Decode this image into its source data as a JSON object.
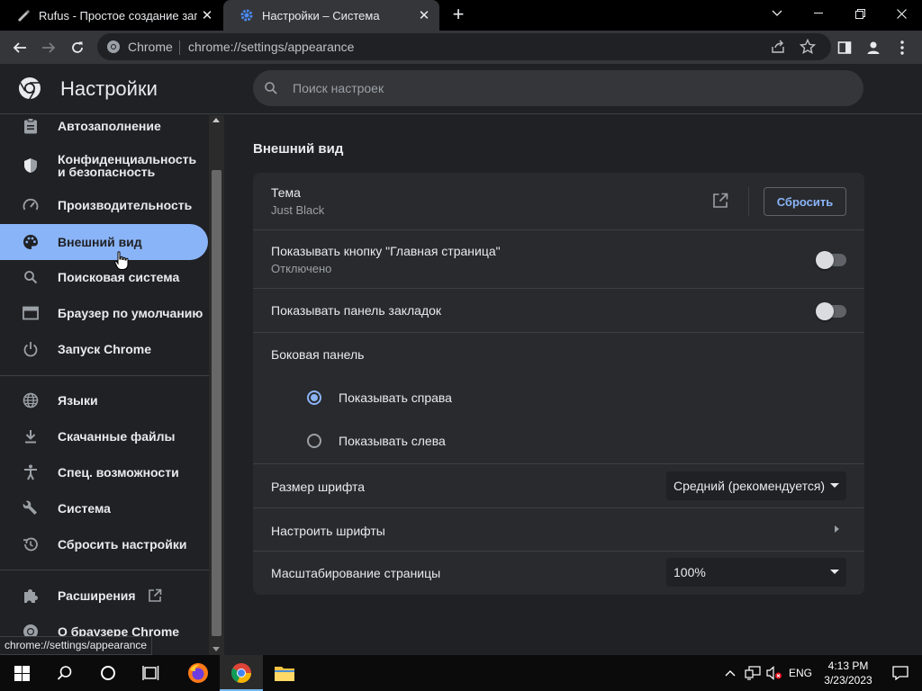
{
  "tabs": [
    {
      "title": "Rufus - Простое создание загру",
      "icon": "rufus-icon"
    },
    {
      "title": "Настройки – Система",
      "icon": "settings-gear-icon"
    }
  ],
  "omnibox": {
    "chip": "Chrome",
    "url": "chrome://settings/appearance"
  },
  "settings": {
    "title": "Настройки",
    "search_placeholder": "Поиск настроек"
  },
  "sidebar": {
    "items": [
      {
        "label": "Автозаполнение",
        "icon": "clipboard-icon"
      },
      {
        "label": "Конфиденциальность и безопасность",
        "icon": "shield-icon"
      },
      {
        "label": "Производительность",
        "icon": "speedometer-icon"
      },
      {
        "label": "Внешний вид",
        "icon": "palette-icon"
      },
      {
        "label": "Поисковая система",
        "icon": "search-icon"
      },
      {
        "label": "Браузер по умолчанию",
        "icon": "browser-window-icon"
      },
      {
        "label": "Запуск Chrome",
        "icon": "power-icon"
      },
      {
        "label": "Языки",
        "icon": "globe-icon"
      },
      {
        "label": "Скачанные файлы",
        "icon": "download-icon"
      },
      {
        "label": "Спец. возможности",
        "icon": "accessibility-icon"
      },
      {
        "label": "Система",
        "icon": "wrench-icon"
      },
      {
        "label": "Сбросить настройки",
        "icon": "history-reset-icon"
      },
      {
        "label": "Расширения",
        "icon": "puzzle-icon"
      },
      {
        "label": "О браузере Chrome",
        "icon": "chrome-logo-icon"
      }
    ]
  },
  "main": {
    "section_title": "Внешний вид",
    "theme_label": "Тема",
    "theme_value": "Just Black",
    "reset_button": "Сбросить",
    "home_button_label": "Показывать кнопку \"Главная страница\"",
    "home_button_status": "Отключено",
    "bookmarks_bar_label": "Показывать панель закладок",
    "side_panel_label": "Боковая панель",
    "side_panel_options": [
      "Показывать справа",
      "Показывать слева"
    ],
    "side_panel_selected": "Показывать справа",
    "font_size_label": "Размер шрифта",
    "font_size_value": "Средний (рекомендуется)",
    "customize_fonts_label": "Настроить шрифты",
    "page_zoom_label": "Масштабирование страницы",
    "page_zoom_value": "100%"
  },
  "status_bubble": "chrome://settings/appearance",
  "taskbar": {
    "language": "ENG",
    "time": "4:13 PM",
    "date": "3/23/2023"
  },
  "colors": {
    "accent": "#8ab4f8",
    "background": "#202124",
    "card": "#292a2d"
  }
}
